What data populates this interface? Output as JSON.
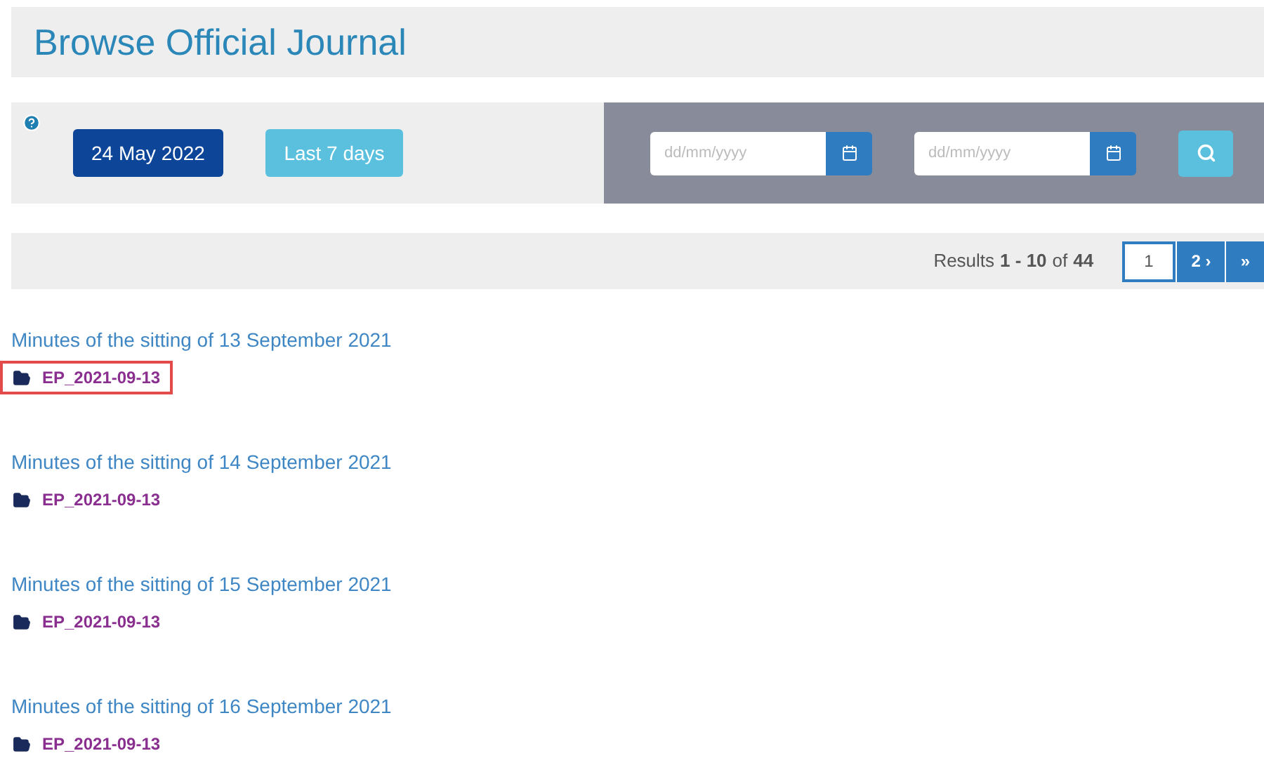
{
  "title": "Browse Official Journal",
  "filters": {
    "date_button": "24 May 2022",
    "range_button": "Last 7 days",
    "date_fields": [
      {
        "placeholder": "dd/mm/yyyy"
      },
      {
        "placeholder": "dd/mm/yyyy"
      }
    ]
  },
  "results": {
    "prefix": "Results",
    "range": "1 - 10",
    "of": "of",
    "total": "44"
  },
  "pagination": [
    {
      "label": "1",
      "selected": true
    },
    {
      "label": "2 ›",
      "selected": false
    },
    {
      "label": "»",
      "selected": false
    }
  ],
  "items": [
    {
      "title": "Minutes of the sitting of 13 September 2021",
      "file": "EP_2021-09-13",
      "highlighted": true
    },
    {
      "title": "Minutes of the sitting of 14 September 2021",
      "file": "EP_2021-09-13",
      "highlighted": false
    },
    {
      "title": "Minutes of the sitting of 15 September 2021",
      "file": "EP_2021-09-13",
      "highlighted": false
    },
    {
      "title": "Minutes of the sitting of 16 September 2021",
      "file": "EP_2021-09-13",
      "highlighted": false
    }
  ]
}
